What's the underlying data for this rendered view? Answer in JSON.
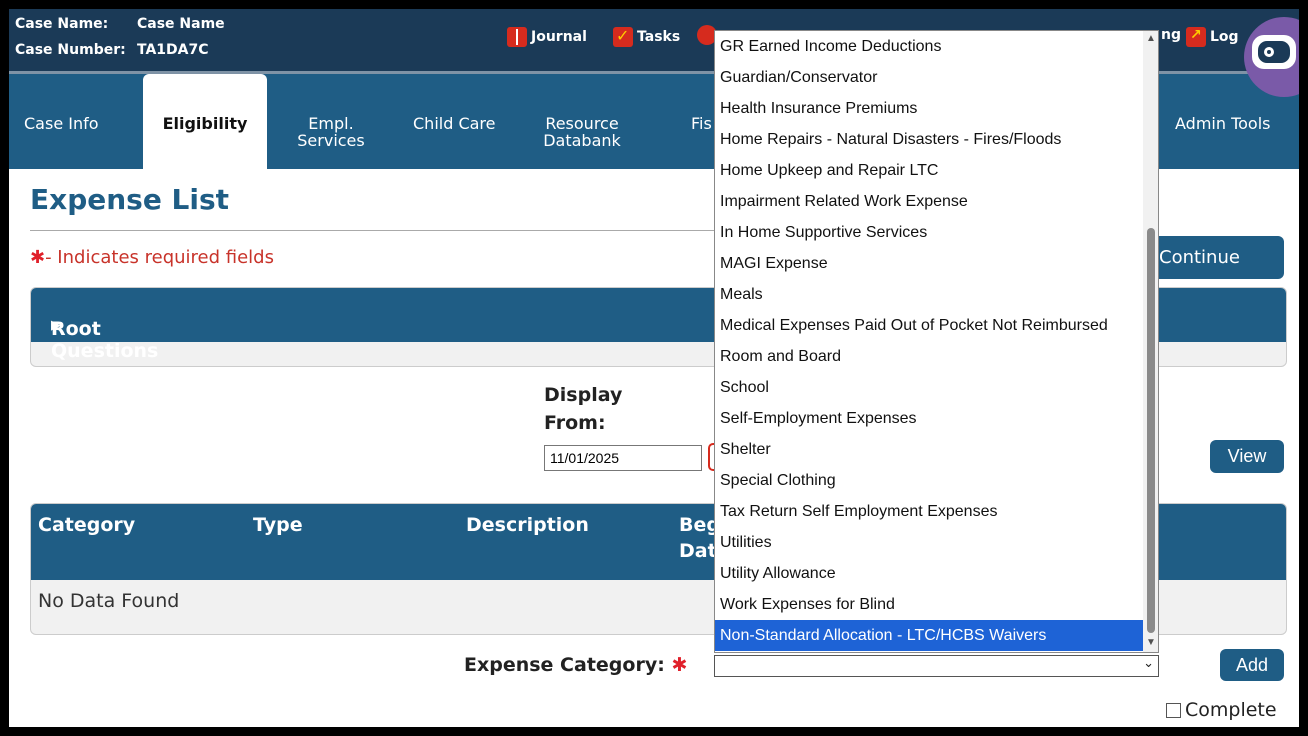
{
  "header": {
    "case_name_label": "Case Name:",
    "case_name_value": "Case Name",
    "case_number_label": "Case Number:",
    "case_number_value": "TA1DA7C",
    "journal": "Journal",
    "tasks": "Tasks",
    "partial_link": "ng",
    "logout_partial": "Log"
  },
  "nav": {
    "items": [
      {
        "label": "Case Info"
      },
      {
        "label": "Eligibility",
        "active": true
      },
      {
        "label": "Empl. Services"
      },
      {
        "label": "Child Care"
      },
      {
        "label": "Resource Databank"
      },
      {
        "label": "Fis"
      },
      {
        "label": "Admin Tools"
      }
    ]
  },
  "page": {
    "title": "Expense List",
    "required_note": "- Indicates required fields",
    "required_star": "✱",
    "continue_label": "Continue",
    "root_questions": "Root Questions",
    "display_from_line1": "Display",
    "display_from_line2": "From:",
    "display_from_value": "11/01/2025",
    "view_label": "View"
  },
  "table": {
    "headers": [
      "Category",
      "Type",
      "Description",
      "Beg",
      "Dat"
    ],
    "empty_text": "No Data Found"
  },
  "form": {
    "expense_category_label": "Expense Category:",
    "required_star": "✱",
    "selected_value": "",
    "add_label": "Add",
    "complete_label": "Complete",
    "complete_checked": false
  },
  "dropdown": {
    "options": [
      "GR Earned Income Deductions",
      "Guardian/Conservator",
      "Health Insurance Premiums",
      "Home Repairs - Natural Disasters - Fires/Floods",
      "Home Upkeep and Repair LTC",
      "Impairment Related Work Expense",
      "In Home Supportive Services",
      "MAGI Expense",
      "Meals",
      "Medical Expenses Paid Out of Pocket Not Reimbursed",
      "Room and Board",
      "School",
      "Self-Employment Expenses",
      "Shelter",
      "Special Clothing",
      "Tax Return Self Employment Expenses",
      "Utilities",
      "Utility Allowance",
      "Work Expenses for Blind",
      "Non-Standard Allocation - LTC/HCBS Waivers"
    ],
    "highlighted": "Non-Standard Allocation - LTC/HCBS Waivers"
  },
  "colors": {
    "header_bg": "#1b3a57",
    "nav_bg": "#1f5d85",
    "accent_red": "#d62b1e",
    "highlight": "#1e63d6"
  }
}
